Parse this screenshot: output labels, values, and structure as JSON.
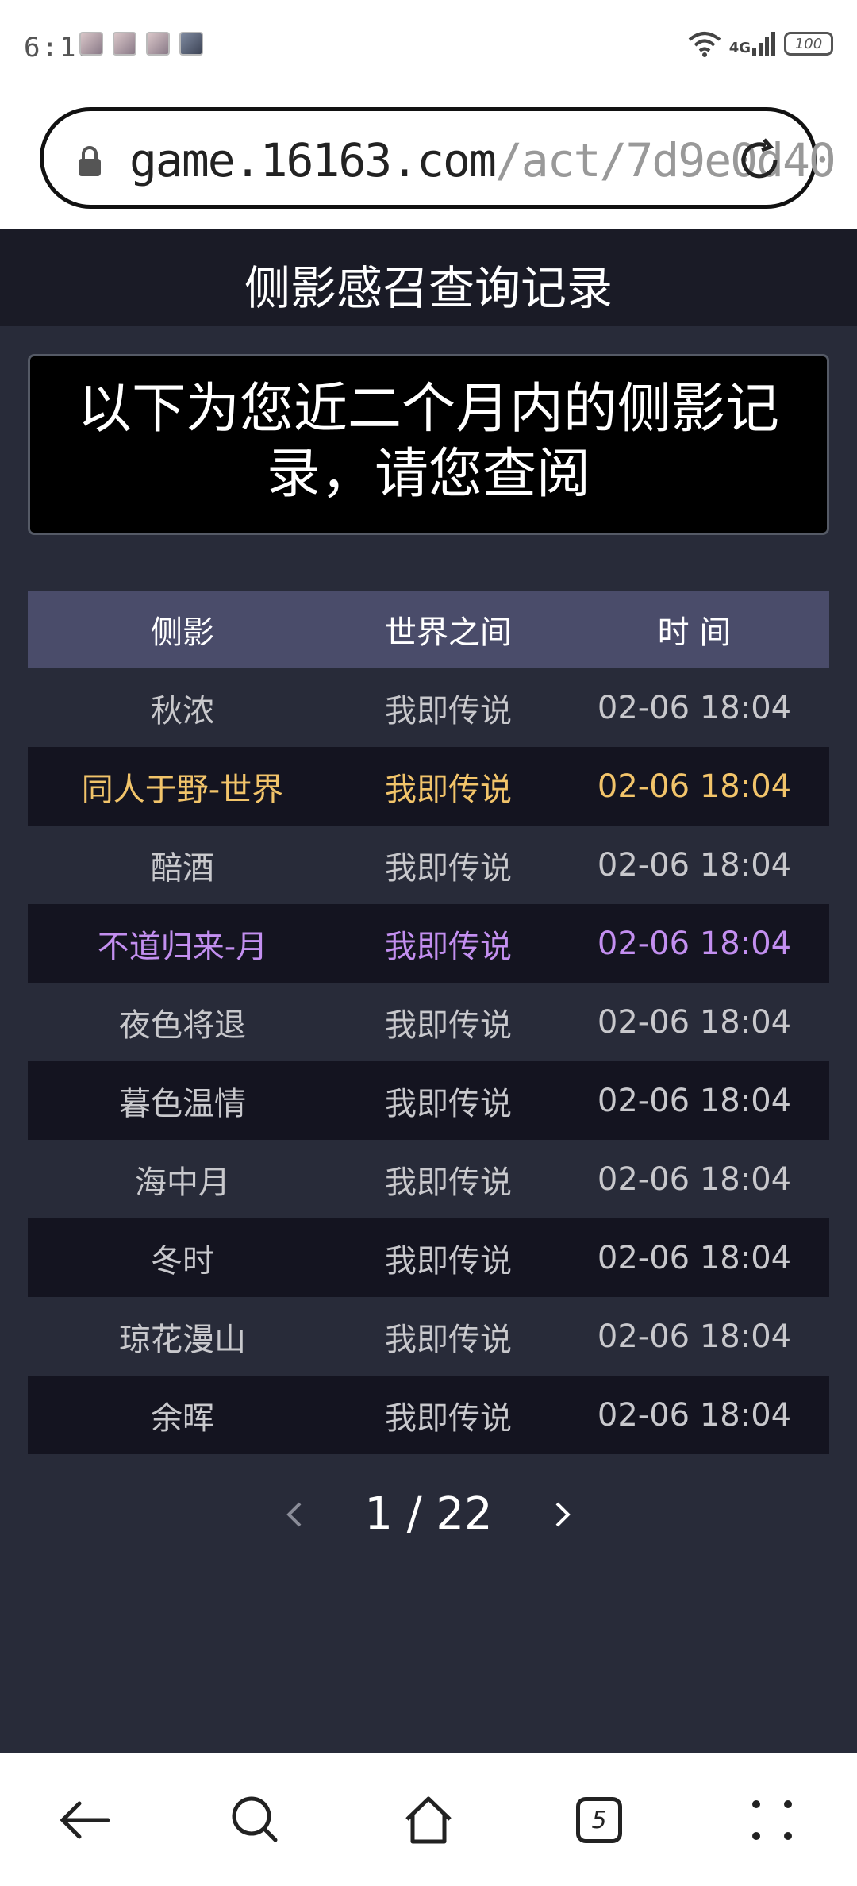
{
  "status_bar": {
    "time": "6:11",
    "network": "4G",
    "battery": "100"
  },
  "browser": {
    "url_host": "game.16163.com",
    "url_path": "/act/7d9e0d40",
    "tab_count": "5"
  },
  "page": {
    "title": "侧影感召查询记录",
    "notice": "以下为您近二个月内的侧影记录，请您查阅"
  },
  "table": {
    "headers": [
      "侧影",
      "世界之间",
      "时 间"
    ],
    "rows": [
      {
        "name": "秋浓",
        "world": "我即传说",
        "time": "02-06 18:04"
      },
      {
        "name": "同人于野-世界",
        "world": "我即传说",
        "time": "02-06 18:04"
      },
      {
        "name": "醅酒",
        "world": "我即传说",
        "time": "02-06 18:04"
      },
      {
        "name": "不道归来-月",
        "world": "我即传说",
        "time": "02-06 18:04"
      },
      {
        "name": "夜色将退",
        "world": "我即传说",
        "time": "02-06 18:04"
      },
      {
        "name": "暮色温情",
        "world": "我即传说",
        "time": "02-06 18:04"
      },
      {
        "name": "海中月",
        "world": "我即传说",
        "time": "02-06 18:04"
      },
      {
        "name": "冬时",
        "world": "我即传说",
        "time": "02-06 18:04"
      },
      {
        "name": "琼花漫山",
        "world": "我即传说",
        "time": "02-06 18:04"
      },
      {
        "name": "余晖",
        "world": "我即传说",
        "time": "02-06 18:04"
      }
    ]
  },
  "pagination": {
    "indicator": "1 / 22"
  },
  "colors": {
    "header_bg": "#1a1b26",
    "page_bg": "#282b39",
    "table_head_bg": "#4a4c6a",
    "gold": "#f2c46a",
    "purple": "#c38ff0"
  }
}
